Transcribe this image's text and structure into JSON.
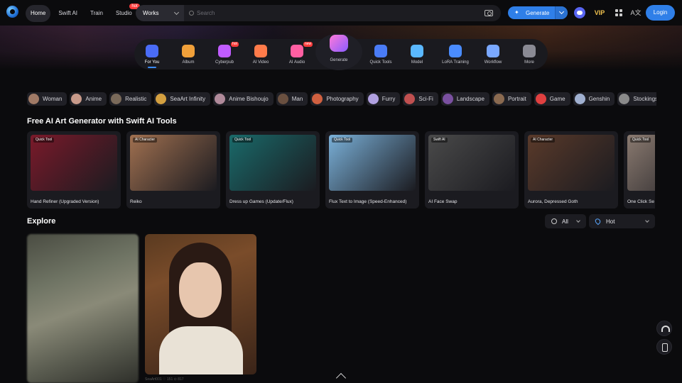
{
  "topbar": {
    "nav": [
      {
        "label": "Home",
        "active": true
      },
      {
        "label": "Swift AI"
      },
      {
        "label": "Train"
      },
      {
        "label": "Studio",
        "badge": "hot"
      }
    ],
    "search": {
      "scope": "Works",
      "placeholder": "Search"
    },
    "generate_label": "Generate",
    "vip_label": "VIP",
    "login_label": "Login",
    "icons": [
      "camera-icon",
      "discord-icon",
      "vip-icon",
      "grid-icon",
      "translate-icon"
    ]
  },
  "dock": {
    "items": [
      {
        "label": "For You",
        "active": true,
        "color": "#4a6cf7"
      },
      {
        "label": "Album",
        "color": "#f0a03a"
      },
      {
        "label": "Cyberpub",
        "badge": "hot",
        "color": "#c05cff"
      },
      {
        "label": "AI Video",
        "color": "#ff7b4a"
      },
      {
        "label": "AI Audio",
        "badge": "new",
        "color": "#ff5fa2"
      },
      {
        "label": "Quick Tools",
        "color": "#4a7cf7"
      },
      {
        "label": "Model",
        "color": "#5ab8ff"
      },
      {
        "label": "LoRA Training",
        "color": "#4a8cff"
      },
      {
        "label": "Workflow",
        "color": "#7aa8ff"
      },
      {
        "label": "More",
        "color": "#8a8a94"
      }
    ],
    "generate_label": "Generate"
  },
  "tags": [
    {
      "label": "Woman",
      "color": "#a07a66"
    },
    {
      "label": "Anime",
      "color": "#c89a8a"
    },
    {
      "label": "Realistic",
      "color": "#7a6a5a"
    },
    {
      "label": "SeaArt Infinity",
      "color": "#d4a040"
    },
    {
      "label": "Anime Bishoujo",
      "color": "#b08a9a"
    },
    {
      "label": "Man",
      "color": "#6a5040"
    },
    {
      "label": "Photography",
      "color": "#d06040"
    },
    {
      "label": "Furry",
      "color": "#b0a0e0"
    },
    {
      "label": "Sci-Fi",
      "color": "#c05050"
    },
    {
      "label": "Landscape",
      "color": "#7a50a0"
    },
    {
      "label": "Portrait",
      "color": "#8a6a50"
    },
    {
      "label": "Game",
      "color": "#e04040"
    },
    {
      "label": "Genshin",
      "color": "#a0b0d0"
    },
    {
      "label": "Stockings",
      "color": "#8a8a8a"
    }
  ],
  "tools_section": {
    "title": "Free AI Art Generator with Swift AI Tools",
    "cards": [
      {
        "chip": "Quick Tool",
        "name": "Hand Refiner (Upgraded Version)",
        "bg": "#7a1a2a"
      },
      {
        "chip": "AI Character",
        "name": "Reiko",
        "bg": "#a07050"
      },
      {
        "chip": "Quick Tool",
        "name": "Dress up Games  (Update/Flux)",
        "bg": "#1a6a6a"
      },
      {
        "chip": "Quick Tool",
        "name": "Flux Text to Image (Speed-Enhanced)",
        "bg": "#7ab0d8"
      },
      {
        "chip": "Swift AI",
        "name": "AI Face Swap",
        "bg": "#4a4a4a"
      },
      {
        "chip": "AI Character",
        "name": "Aurora, Depressed Goth",
        "bg": "#5a3a2a"
      },
      {
        "chip": "Quick Tool",
        "name": "One Click Se",
        "bg": "#8a7a70"
      }
    ]
  },
  "explore": {
    "title": "Explore",
    "filter_all": "All",
    "filter_sort": "Hot",
    "stats_text": "SeaArt001    ♡ 151    ⊙ 817"
  }
}
